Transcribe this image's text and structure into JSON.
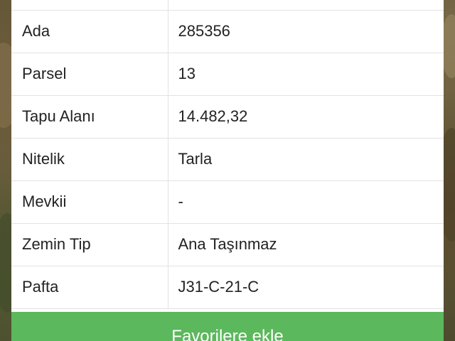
{
  "rows": [
    {
      "label": "Ada",
      "value": "285356"
    },
    {
      "label": "Parsel",
      "value": "13"
    },
    {
      "label": "Tapu Alanı",
      "value": "14.482,32"
    },
    {
      "label": "Nitelik",
      "value": "Tarla"
    },
    {
      "label": "Mevkii",
      "value": "-"
    },
    {
      "label": "Zemin Tip",
      "value": "Ana Taşınmaz"
    },
    {
      "label": "Pafta",
      "value": "J31-C-21-C"
    }
  ],
  "actions": {
    "add_favorites_label": "Favorilere ekle"
  },
  "colors": {
    "button": "#5cb85c",
    "card_background": "#ffffff",
    "border": "#e2e2e2"
  }
}
